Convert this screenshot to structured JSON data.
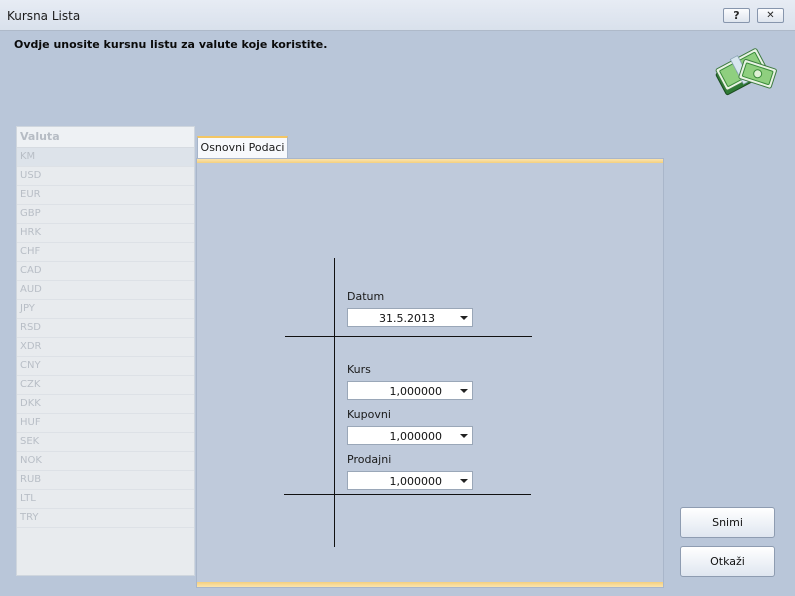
{
  "window": {
    "title": "Kursna Lista",
    "help_label": "?",
    "close_label": "✕"
  },
  "header": {
    "text": "Ovdje unosite kursnu listu za valute koje koristite.",
    "icon": "money-stack-icon"
  },
  "grid": {
    "column_header": "Valuta",
    "rows": [
      "KM",
      "USD",
      "EUR",
      "GBP",
      "HRK",
      "CHF",
      "CAD",
      "AUD",
      "JPY",
      "RSD",
      "XDR",
      "CNY",
      "CZK",
      "DKK",
      "HUF",
      "SEK",
      "NOK",
      "RUB",
      "LTL",
      "TRY"
    ]
  },
  "tabs": [
    {
      "label": "Osnovni Podaci"
    }
  ],
  "form": {
    "datum": {
      "label": "Datum",
      "value": "31.5.2013"
    },
    "kurs": {
      "label": "Kurs",
      "value": "1,000000"
    },
    "kupovni": {
      "label": "Kupovni",
      "value": "1,000000"
    },
    "prodajni": {
      "label": "Prodajni",
      "value": "1,000000"
    }
  },
  "buttons": {
    "save": "Snimi",
    "cancel": "Otkaži"
  },
  "colors": {
    "background": "#b9c6d9",
    "tab_accent": "#f3c664"
  }
}
